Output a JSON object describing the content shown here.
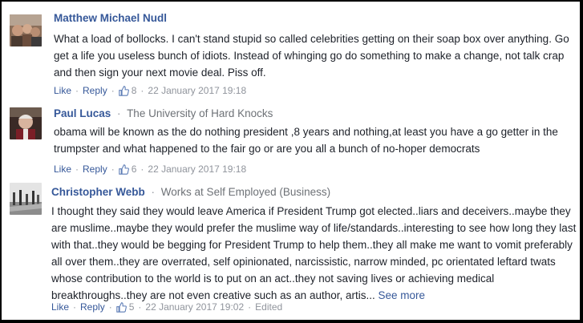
{
  "comments": [
    {
      "author": "Matthew Michael Nudl",
      "workplace": "",
      "text": "What a load of bollocks. I can't stand stupid so called celebrities getting on their soap box over anything. Go get a life you useless bunch of idiots. Instead of whinging go do something to make a change, not talk crap and then sign your next movie deal. Piss off.",
      "like_label": "Like",
      "reply_label": "Reply",
      "likes": "8",
      "timestamp": "22 January 2017 19:18"
    },
    {
      "author": "Paul Lucas",
      "workplace": "The University of Hard Knocks",
      "text": "obama will be known as the do nothing president ,8 years and nothing,at least you have a go getter in the trumpster and what happened to the fair go or are you all a bunch of no-hoper democrats",
      "like_label": "Like",
      "reply_label": "Reply",
      "likes": "6",
      "timestamp": "22 January 2017 19:18"
    },
    {
      "author": "Christopher Webb",
      "workplace": "Works at Self Employed (Business)",
      "text": "I thought they said they would leave America if President Trump got elected..liars and deceivers..maybe they are muslime..maybe they would prefer the muslime way of life/standards..interesting to see how long they last with that..they would be begging for President Trump to help them..they all make me want to vomit preferably all over them..they are overrated, self opinionated, narcissistic, narrow minded, pc orientated leftard twats whose contribution to the world is to put on an act..they not saving lives or achieving medical breakthroughs..they are not even creative such as an author, artis...",
      "see_more": "See more",
      "like_label": "Like",
      "reply_label": "Reply",
      "likes": "5",
      "timestamp": "22 January 2017 19:02",
      "edited": "Edited"
    }
  ],
  "colors": {
    "name_blue": "#365899",
    "meta_grey": "#90949c",
    "text": "#1d2129"
  },
  "icons": [
    "thumbs-up-icon",
    "avatar"
  ]
}
